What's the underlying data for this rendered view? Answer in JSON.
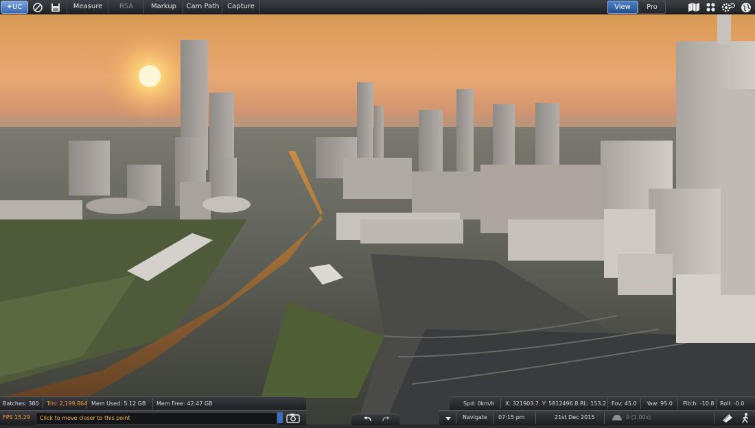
{
  "toolbar": {
    "logo_label": "UC",
    "measure": "Measure",
    "rsa": "RSA",
    "markup": "Markup",
    "campath": "Cam Path",
    "capture": "Capture",
    "view": "View",
    "pro": "Pro"
  },
  "stats": {
    "batches": "Batches: 380",
    "tris": "Tris: 2,199,864",
    "mem_used": "Mem Used: 5.12 GB",
    "mem_free": "Mem Free: 42.47 GB",
    "fps": "FPS 15.29",
    "hint": "Click to move closer to this point"
  },
  "camera": {
    "speed": "Spd: 0km/h",
    "x": "X: 321903.7",
    "y": "Y: 5812496.8",
    "rl": "RL: 153.2",
    "fov": "Fov: 45.0",
    "yaw": "Yaw: 95.0",
    "pitch": "Pitch: -10.8",
    "roll": "Roll: -0.0",
    "mode": "Navigate",
    "time": "07:15 pm",
    "date": "21st Dec 2015",
    "playback": "0 (1.00x)"
  },
  "colors": {
    "accent": "#3a6fc0",
    "highlight": "#ff9a2e",
    "panel": "#232427"
  },
  "icons": [
    "no-entry-icon",
    "save-icon",
    "camera-icon",
    "undo-icon",
    "redo-icon",
    "dropdown-icon",
    "car-icon",
    "settings-icon",
    "globe-icon",
    "grid-icon",
    "map-icon",
    "walker-icon",
    "book-icon"
  ]
}
